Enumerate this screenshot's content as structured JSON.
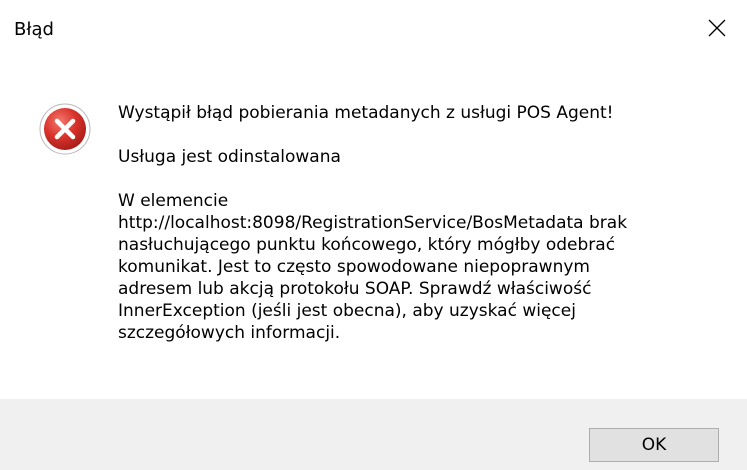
{
  "window": {
    "title": "Błąd"
  },
  "titlebar": {
    "close_icon": "close-icon"
  },
  "message": {
    "icon": "error-icon",
    "icon_color": "#d9322c",
    "line1": "Wystąpił błąd pobierania metadanych z usługi POS Agent!",
    "line2": "Usługa jest odinstalowana",
    "detail": "W elemencie\nhttp://localhost:8098/RegistrationService/BosMetadata brak\nnasłuchującego punktu końcowego, który mógłby odebrać\nkomunikat. Jest to często spowodowane niepoprawnym\nadresem lub akcją protokołu SOAP. Sprawdź właściwość\nInnerException (jeśli jest obecna), aby uzyskać więcej\nszczegółowych informacji."
  },
  "footer": {
    "ok_label": "OK",
    "background": "#f0f0f0"
  }
}
